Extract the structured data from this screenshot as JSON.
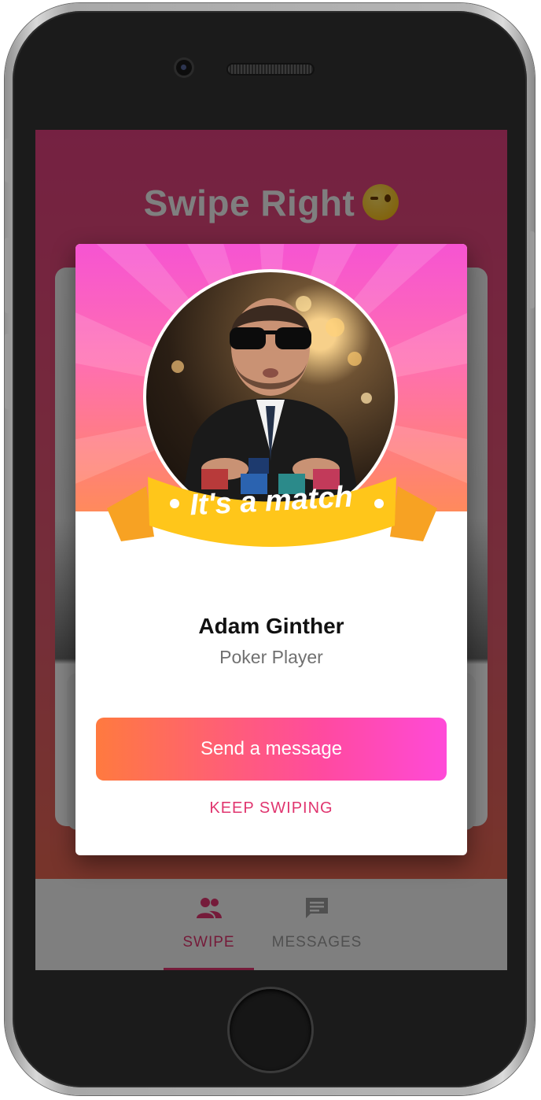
{
  "app": {
    "title": "Swipe Right",
    "title_emoji": "winking-face"
  },
  "match_modal": {
    "banner_text": "It's a match",
    "name": "Adam Ginther",
    "role": "Poker Player",
    "send_label": "Send a message",
    "keep_label": "KEEP SWIPING"
  },
  "tabs": [
    {
      "label": "SWIPE",
      "icon": "people-icon",
      "active": true
    },
    {
      "label": "MESSAGES",
      "icon": "chat-icon",
      "active": false
    }
  ],
  "colors": {
    "accent": "#e0356f",
    "gradient_start": "#ff7a3f",
    "gradient_end": "#ff4ad8",
    "banner": "#ffc61a"
  }
}
